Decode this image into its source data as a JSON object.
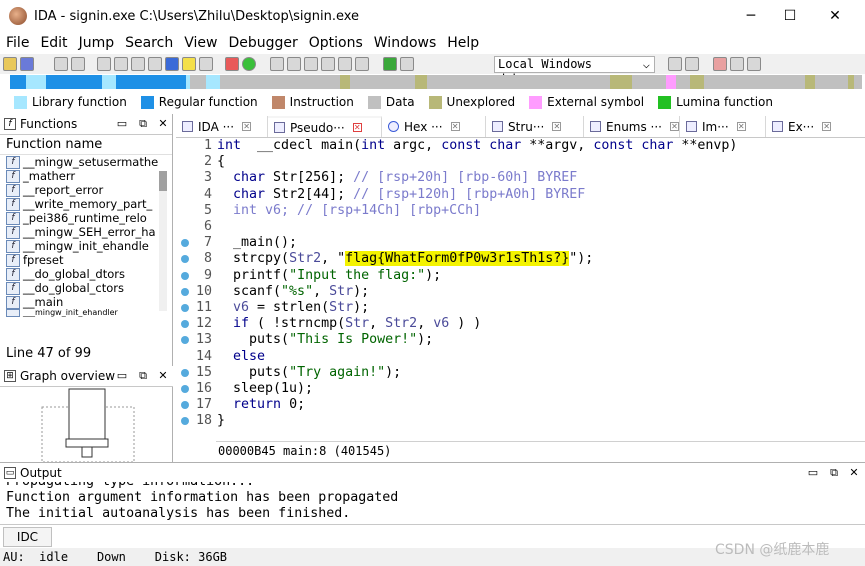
{
  "window": {
    "title": "IDA - signin.exe C:\\Users\\Zhilu\\Desktop\\signin.exe",
    "minimize": "─",
    "maximize": "☐",
    "close": "✕"
  },
  "menu": [
    "File",
    "Edit",
    "Jump",
    "Search",
    "View",
    "Debugger",
    "Options",
    "Windows",
    "Help"
  ],
  "toolbar": {
    "debugger_select": "Local Windows debugger",
    "debugger_arrow": "⌵"
  },
  "legend": [
    {
      "label": "Library function",
      "color": "#a6e7ff"
    },
    {
      "label": "Regular function",
      "color": "#1e90e6"
    },
    {
      "label": "Instruction",
      "color": "#c0876a"
    },
    {
      "label": "Data",
      "color": "#c0c0c0"
    },
    {
      "label": "Unexplored",
      "color": "#b8b878"
    },
    {
      "label": "External symbol",
      "color": "#ff9cff"
    },
    {
      "label": "Lumina function",
      "color": "#22c022"
    }
  ],
  "functions_panel": {
    "title": "Functions",
    "header": "Function name",
    "items": [
      "__mingw_setusermathe",
      "_matherr",
      "__report_error",
      "__write_memory_part_",
      "_pei386_runtime_relo",
      "__mingw_SEH_error_ha",
      "__mingw_init_ehandle",
      "fpreset",
      "__do_global_dtors",
      "__do_global_ctors",
      "__main",
      "___mingw_init_ehandler"
    ],
    "line_count": "Line 47 of 99"
  },
  "graph_panel": {
    "title": "Graph overview"
  },
  "tabs": [
    "IDA ···",
    "Pseudo···",
    "Hex ···",
    "Stru···",
    "Enums ···",
    "Im···",
    "Ex···"
  ],
  "code_lines": [
    {
      "n": "1",
      "dot": false,
      "parts": [
        [
          "kw",
          "int"
        ],
        [
          "",
          "  __cdecl main("
        ],
        [
          "kw",
          "int"
        ],
        [
          "",
          " argc, "
        ],
        [
          "kw",
          "const char"
        ],
        [
          "",
          " **argv, "
        ],
        [
          "kw",
          "const char"
        ],
        [
          "",
          " **envp)"
        ]
      ]
    },
    {
      "n": "2",
      "dot": false,
      "parts": [
        [
          "",
          "{"
        ]
      ]
    },
    {
      "n": "3",
      "dot": false,
      "parts": [
        [
          "",
          "  "
        ],
        [
          "kw",
          "char"
        ],
        [
          "",
          " Str[256]; "
        ],
        [
          "cm",
          "// [rsp+20h] [rbp-60h] BYREF"
        ]
      ]
    },
    {
      "n": "4",
      "dot": false,
      "parts": [
        [
          "",
          "  "
        ],
        [
          "kw",
          "char"
        ],
        [
          "",
          " Str2[44]; "
        ],
        [
          "cm",
          "// [rsp+120h] [rbp+A0h] BYREF"
        ]
      ]
    },
    {
      "n": "5",
      "dot": false,
      "parts": [
        [
          "",
          "  "
        ],
        [
          "cm",
          "int v6; // [rsp+14Ch] [rbp+CCh]"
        ]
      ]
    },
    {
      "n": "6",
      "dot": false,
      "parts": [
        [
          "",
          ""
        ]
      ]
    },
    {
      "n": "7",
      "dot": true,
      "parts": [
        [
          "",
          "  _main();"
        ]
      ]
    },
    {
      "n": "8",
      "dot": true,
      "parts": [
        [
          "",
          "  strcpy("
        ],
        [
          "va",
          "Str2"
        ],
        [
          "",
          ", \""
        ],
        [
          "hl",
          "flag{WhatForm0fP0w3r1sTh1s?}"
        ],
        [
          "",
          "\");"
        ]
      ]
    },
    {
      "n": "9",
      "dot": true,
      "parts": [
        [
          "",
          "  printf("
        ],
        [
          "st",
          "\"Input the flag:\""
        ],
        [
          "",
          ");"
        ]
      ]
    },
    {
      "n": "10",
      "dot": true,
      "parts": [
        [
          "",
          "  scanf("
        ],
        [
          "st",
          "\"%s\""
        ],
        [
          "",
          ", "
        ],
        [
          "va",
          "Str"
        ],
        [
          "",
          ");"
        ]
      ]
    },
    {
      "n": "11",
      "dot": true,
      "parts": [
        [
          "",
          "  "
        ],
        [
          "va",
          "v6"
        ],
        [
          "",
          " = strlen("
        ],
        [
          "va",
          "Str"
        ],
        [
          "",
          ");"
        ]
      ]
    },
    {
      "n": "12",
      "dot": true,
      "parts": [
        [
          "",
          "  "
        ],
        [
          "kw",
          "if"
        ],
        [
          "",
          " ( !strncmp("
        ],
        [
          "va",
          "Str"
        ],
        [
          "",
          ", "
        ],
        [
          "va",
          "Str2"
        ],
        [
          "",
          ", "
        ],
        [
          "va",
          "v6"
        ],
        [
          "",
          " ) )"
        ]
      ]
    },
    {
      "n": "13",
      "dot": true,
      "parts": [
        [
          "",
          "    puts("
        ],
        [
          "st",
          "\"This Is Power!\""
        ],
        [
          "",
          ");"
        ]
      ]
    },
    {
      "n": "14",
      "dot": false,
      "parts": [
        [
          "",
          "  "
        ],
        [
          "kw",
          "else"
        ]
      ]
    },
    {
      "n": "15",
      "dot": true,
      "parts": [
        [
          "",
          "    puts("
        ],
        [
          "st",
          "\"Try again!\""
        ],
        [
          "",
          ");"
        ]
      ]
    },
    {
      "n": "16",
      "dot": true,
      "parts": [
        [
          "",
          "  sleep(1u);"
        ]
      ]
    },
    {
      "n": "17",
      "dot": true,
      "parts": [
        [
          "",
          "  "
        ],
        [
          "kw",
          "return"
        ],
        [
          "",
          " 0;"
        ]
      ]
    },
    {
      "n": "18",
      "dot": true,
      "parts": [
        [
          "",
          "}"
        ]
      ]
    }
  ],
  "code_status": "00000B45 main:8 (401545)",
  "output": {
    "title": "Output",
    "lines": [
      "Propagating type information...",
      "Function argument information has been propagated",
      "The initial autoanalysis has been finished."
    ]
  },
  "idc_button": "IDC",
  "status": {
    "au": "AU:",
    "state": "idle",
    "direction": "Down",
    "disk": "Disk: 36GB"
  },
  "watermark": "CSDN @纸鹿本鹿"
}
